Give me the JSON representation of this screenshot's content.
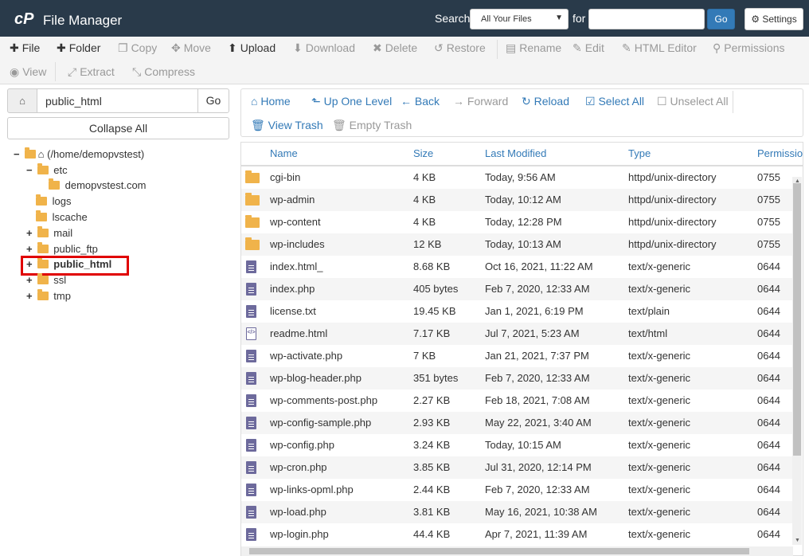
{
  "header": {
    "logo": "cP",
    "title": "File Manager",
    "search_label": "Search",
    "search_scope": "All Your Files",
    "for_label": "for",
    "search_value": "",
    "go_label": "Go",
    "settings_label": "Settings"
  },
  "toolbar": {
    "row1": [
      {
        "label": "File",
        "icon": "plus-icon",
        "active": true
      },
      {
        "label": "Folder",
        "icon": "plus-icon",
        "active": true
      },
      {
        "label": "Copy",
        "icon": "copy-icon",
        "active": false
      },
      {
        "label": "Move",
        "icon": "move-icon",
        "active": false
      },
      {
        "label": "Upload",
        "icon": "upload-icon",
        "active": true
      },
      {
        "label": "Download",
        "icon": "download-icon",
        "active": false
      },
      {
        "label": "Delete",
        "icon": "delete-icon",
        "active": false
      },
      {
        "label": "Restore",
        "icon": "restore-icon",
        "active": false
      },
      {
        "label": "Rename",
        "icon": "rename-icon",
        "active": false
      },
      {
        "label": "Edit",
        "icon": "pencil-icon",
        "active": false
      },
      {
        "label": "HTML Editor",
        "icon": "html-editor-icon",
        "active": false
      },
      {
        "label": "Permissions",
        "icon": "key-icon",
        "active": false
      }
    ],
    "row2": [
      {
        "label": "View",
        "icon": "eye-icon",
        "active": false
      },
      {
        "label": "Extract",
        "icon": "extract-icon",
        "active": false
      },
      {
        "label": "Compress",
        "icon": "compress-icon",
        "active": false
      }
    ]
  },
  "left": {
    "path_value": "public_html",
    "go_label": "Go",
    "collapse_label": "Collapse All",
    "tree": [
      {
        "label": "(/home/demopvstest)",
        "toggle": "−",
        "kind": "home"
      },
      {
        "label": "etc",
        "toggle": "−",
        "kind": "open-folder"
      },
      {
        "label": "demopvstest.com",
        "toggle": "",
        "kind": "folder"
      },
      {
        "label": "logs",
        "toggle": "",
        "kind": "folder"
      },
      {
        "label": "lscache",
        "toggle": "",
        "kind": "folder"
      },
      {
        "label": "mail",
        "toggle": "+",
        "kind": "folder"
      },
      {
        "label": "public_ftp",
        "toggle": "+",
        "kind": "folder"
      },
      {
        "label": "public_html",
        "toggle": "+",
        "kind": "folder",
        "selected": true
      },
      {
        "label": "ssl",
        "toggle": "+",
        "kind": "folder"
      },
      {
        "label": "tmp",
        "toggle": "+",
        "kind": "folder"
      }
    ]
  },
  "nav": {
    "home": "Home",
    "up": "Up One Level",
    "back": "Back",
    "forward": "Forward",
    "reload": "Reload",
    "select_all": "Select All",
    "unselect_all": "Unselect All",
    "view_trash": "View Trash",
    "empty_trash": "Empty Trash"
  },
  "table": {
    "columns": [
      "Name",
      "Size",
      "Last Modified",
      "Type",
      "Permissions"
    ],
    "rows": [
      {
        "icon": "folder",
        "name": "cgi-bin",
        "size": "4 KB",
        "modified": "Today, 9:56 AM",
        "type": "httpd/unix-directory",
        "perms": "0755"
      },
      {
        "icon": "folder",
        "name": "wp-admin",
        "size": "4 KB",
        "modified": "Today, 10:12 AM",
        "type": "httpd/unix-directory",
        "perms": "0755"
      },
      {
        "icon": "folder",
        "name": "wp-content",
        "size": "4 KB",
        "modified": "Today, 12:28 PM",
        "type": "httpd/unix-directory",
        "perms": "0755"
      },
      {
        "icon": "folder",
        "name": "wp-includes",
        "size": "12 KB",
        "modified": "Today, 10:13 AM",
        "type": "httpd/unix-directory",
        "perms": "0755"
      },
      {
        "icon": "file",
        "name": "index.html_",
        "size": "8.68 KB",
        "modified": "Oct 16, 2021, 11:22 AM",
        "type": "text/x-generic",
        "perms": "0644"
      },
      {
        "icon": "file",
        "name": "index.php",
        "size": "405 bytes",
        "modified": "Feb 7, 2020, 12:33 AM",
        "type": "text/x-generic",
        "perms": "0644"
      },
      {
        "icon": "file",
        "name": "license.txt",
        "size": "19.45 KB",
        "modified": "Jan 1, 2021, 6:19 PM",
        "type": "text/plain",
        "perms": "0644"
      },
      {
        "icon": "code",
        "name": "readme.html",
        "size": "7.17 KB",
        "modified": "Jul 7, 2021, 5:23 AM",
        "type": "text/html",
        "perms": "0644"
      },
      {
        "icon": "file",
        "name": "wp-activate.php",
        "size": "7 KB",
        "modified": "Jan 21, 2021, 7:37 PM",
        "type": "text/x-generic",
        "perms": "0644"
      },
      {
        "icon": "file",
        "name": "wp-blog-header.php",
        "size": "351 bytes",
        "modified": "Feb 7, 2020, 12:33 AM",
        "type": "text/x-generic",
        "perms": "0644"
      },
      {
        "icon": "file",
        "name": "wp-comments-post.php",
        "size": "2.27 KB",
        "modified": "Feb 18, 2021, 7:08 AM",
        "type": "text/x-generic",
        "perms": "0644"
      },
      {
        "icon": "file",
        "name": "wp-config-sample.php",
        "size": "2.93 KB",
        "modified": "May 22, 2021, 3:40 AM",
        "type": "text/x-generic",
        "perms": "0644"
      },
      {
        "icon": "file",
        "name": "wp-config.php",
        "size": "3.24 KB",
        "modified": "Today, 10:15 AM",
        "type": "text/x-generic",
        "perms": "0644"
      },
      {
        "icon": "file",
        "name": "wp-cron.php",
        "size": "3.85 KB",
        "modified": "Jul 31, 2020, 12:14 PM",
        "type": "text/x-generic",
        "perms": "0644"
      },
      {
        "icon": "file",
        "name": "wp-links-opml.php",
        "size": "2.44 KB",
        "modified": "Feb 7, 2020, 12:33 AM",
        "type": "text/x-generic",
        "perms": "0644"
      },
      {
        "icon": "file",
        "name": "wp-load.php",
        "size": "3.81 KB",
        "modified": "May 16, 2021, 10:38 AM",
        "type": "text/x-generic",
        "perms": "0644"
      },
      {
        "icon": "file",
        "name": "wp-login.php",
        "size": "44.4 KB",
        "modified": "Apr 7, 2021, 11:39 AM",
        "type": "text/x-generic",
        "perms": "0644"
      }
    ]
  }
}
